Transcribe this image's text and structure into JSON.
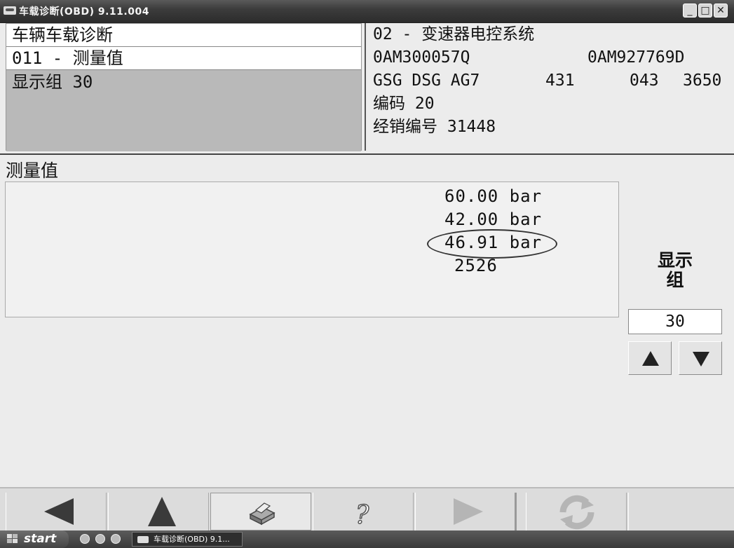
{
  "window": {
    "title": "车载诊断(OBD) 9.11.004",
    "min_label": "_",
    "max_label": "□",
    "close_label": "✕"
  },
  "left_panel": {
    "row1": "车辆车载诊断",
    "row2": "011 - 测量值",
    "row3": "显示组 30"
  },
  "right_panel": {
    "system": "02 - 变速器电控系统",
    "part_no_1": "0AM300057Q",
    "part_no_2": "0AM927769D",
    "component": "GSG DSG AG7",
    "comp_val_1": "431",
    "comp_val_2": "043",
    "comp_val_3": "3650",
    "coding": "编码 20",
    "dealer": "经销编号 31448"
  },
  "measurements": {
    "heading": "测量值",
    "values": [
      "60.00 bar",
      "42.00 bar",
      "46.91 bar",
      "2526"
    ]
  },
  "display_group": {
    "label_line1": "显示",
    "label_line2": "组",
    "value": "30"
  },
  "toolbar": {
    "icons": [
      "arrow-left-icon",
      "arrow-up-icon",
      "print-icon",
      "help-icon",
      "arrow-right-icon",
      "refresh-icon"
    ]
  },
  "taskbar": {
    "start_label": "start",
    "task_label": "车载诊断(OBD) 9.1..."
  },
  "colors": {
    "selected_row": "#b9b9b9",
    "disabled_icon": "#b5b5b5",
    "active_icon": "#3a3a3a"
  }
}
